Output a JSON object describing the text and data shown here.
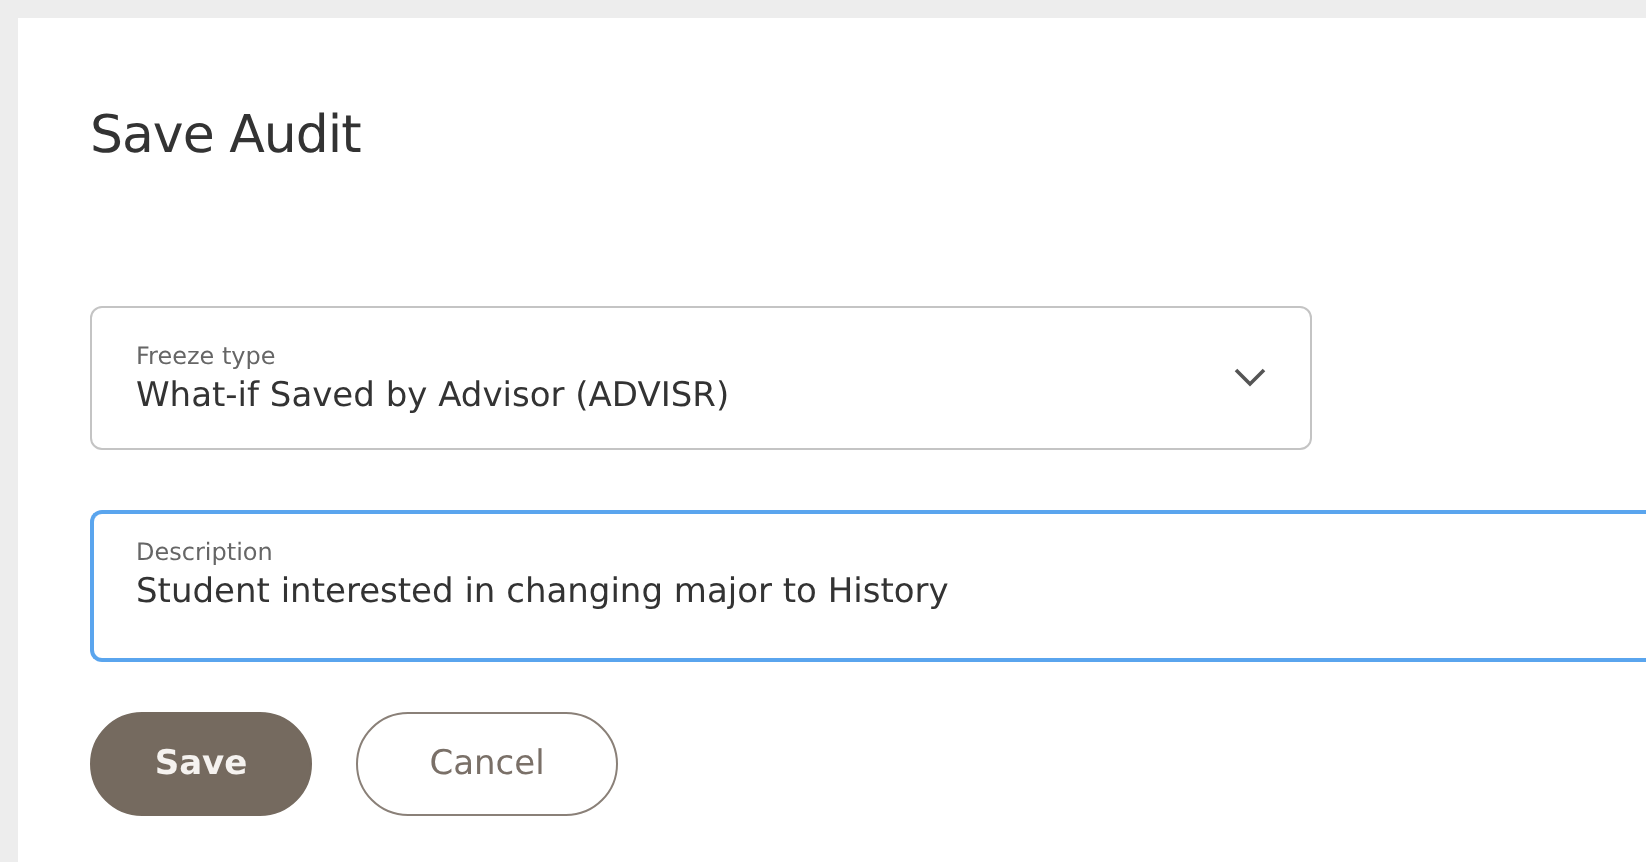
{
  "dialog": {
    "title": "Save Audit"
  },
  "freeze_type": {
    "label": "Freeze type",
    "value": "What-if Saved by Advisor (ADVISR)"
  },
  "description": {
    "label": "Description",
    "value": "Student interested in changing major to History",
    "focused": true
  },
  "buttons": [
    {
      "label": "Save",
      "kind": "primary"
    },
    {
      "label": "Cancel",
      "kind": "secondary"
    }
  ]
}
